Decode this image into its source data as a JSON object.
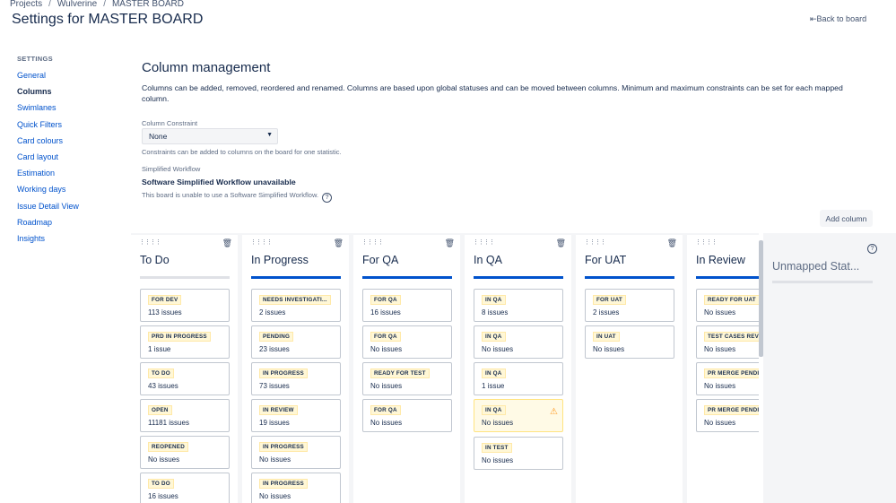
{
  "breadcrumb": {
    "projects": "Projects",
    "project": "Wulverine",
    "board": "MASTER BOARD"
  },
  "page_title": "Settings for MASTER BOARD",
  "back_link": "Back to board",
  "sidebar": {
    "heading": "SETTINGS",
    "items": [
      {
        "label": "General"
      },
      {
        "label": "Columns",
        "active": true
      },
      {
        "label": "Swimlanes"
      },
      {
        "label": "Quick Filters"
      },
      {
        "label": "Card colours"
      },
      {
        "label": "Card layout"
      },
      {
        "label": "Estimation"
      },
      {
        "label": "Working days"
      },
      {
        "label": "Issue Detail View"
      },
      {
        "label": "Roadmap"
      },
      {
        "label": "Insights"
      }
    ]
  },
  "main": {
    "title": "Column management",
    "description": "Columns can be added, removed, reordered and renamed. Columns are based upon global statuses and can be moved between columns. Minimum and maximum constraints can be set for each mapped column.",
    "constraint_label": "Column Constraint",
    "constraint_value": "None",
    "constraint_help": "Constraints can be added to columns on the board for one statistic.",
    "workflow_label": "Simplified Workflow",
    "workflow_title": "Software Simplified Workflow unavailable",
    "workflow_help": "This board is unable to use a Software Simplified Workflow.",
    "add_column": "Add column"
  },
  "columns": [
    {
      "name": "To Do",
      "cards": [
        {
          "status": "FOR DEV",
          "count": "113 issues"
        },
        {
          "status": "PRD IN PROGRESS",
          "count": "1 issue"
        },
        {
          "status": "TO DO",
          "count": "43 issues"
        },
        {
          "status": "OPEN",
          "count": "11181 issues"
        },
        {
          "status": "REOPENED",
          "count": "No issues"
        },
        {
          "status": "TO DO",
          "count": "16 issues"
        }
      ]
    },
    {
      "name": "In Progress",
      "cards": [
        {
          "status": "NEEDS INVESTIGATI...",
          "count": "2 issues"
        },
        {
          "status": "PENDING",
          "count": "23 issues"
        },
        {
          "status": "IN PROGRESS",
          "count": "73 issues"
        },
        {
          "status": "IN REVIEW",
          "count": "19 issues"
        },
        {
          "status": "IN PROGRESS",
          "count": "No issues"
        },
        {
          "status": "IN PROGRESS",
          "count": "No issues"
        }
      ]
    },
    {
      "name": "For QA",
      "cards": [
        {
          "status": "FOR QA",
          "count": "16 issues"
        },
        {
          "status": "FOR QA",
          "count": "No issues"
        },
        {
          "status": "READY FOR TEST",
          "count": "No issues"
        },
        {
          "status": "FOR QA",
          "count": "No issues"
        }
      ]
    },
    {
      "name": "In QA",
      "cards": [
        {
          "status": "IN QA",
          "count": "8 issues"
        },
        {
          "status": "IN QA",
          "count": "No issues"
        },
        {
          "status": "IN QA",
          "count": "1 issue"
        },
        {
          "status": "IN QA",
          "count": "No issues",
          "warning": true
        },
        {
          "status": "IN TEST",
          "count": "No issues"
        }
      ]
    },
    {
      "name": "For UAT",
      "cards": [
        {
          "status": "FOR UAT",
          "count": "2 issues"
        },
        {
          "status": "IN UAT",
          "count": "No issues"
        }
      ]
    },
    {
      "name": "In Review",
      "cards": [
        {
          "status": "READY FOR UAT",
          "count": "No issues"
        },
        {
          "status": "TEST CASES REVI",
          "count": "No issues"
        },
        {
          "status": "PR MERGE PENDI",
          "count": "No issues"
        },
        {
          "status": "PR MERGE PENDI",
          "count": "No issues"
        }
      ]
    }
  ],
  "unmapped": {
    "name": "Unmapped Stat..."
  },
  "colors": {
    "accent": "#0052cc",
    "lozenge_bg": "#fff7d6",
    "warning": "#ff991f"
  }
}
